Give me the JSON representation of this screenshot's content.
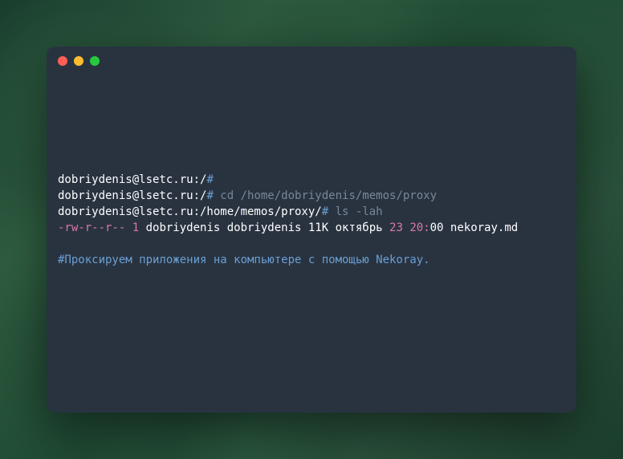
{
  "terminal": {
    "lines": {
      "l1": {
        "prompt_user": "dobriydenis@lsetc.ru:/",
        "prompt_hash": "#"
      },
      "l2": {
        "prompt_user": "dobriydenis@lsetc.ru:/",
        "prompt_hash": "#",
        "cmd": " cd /home/dobriydenis/memos/proxy"
      },
      "l3": {
        "prompt_user": "dobriydenis@lsetc.ru:/home/memos/proxy/",
        "prompt_hash": "#",
        "cmd": " ls -lah"
      },
      "l4": {
        "perms": "-rw-r--r--",
        "links": " 1",
        "owner_size": " dobriydenis dobriydenis 11K октябрь ",
        "day": "23",
        "sp1": " ",
        "hour": "20",
        "colon": ":",
        "minute": "00",
        "filename": " nekoray.md"
      },
      "l5": {
        "heading": "#Проксируем приложения на компьютере с помощью Nekoray."
      }
    }
  }
}
